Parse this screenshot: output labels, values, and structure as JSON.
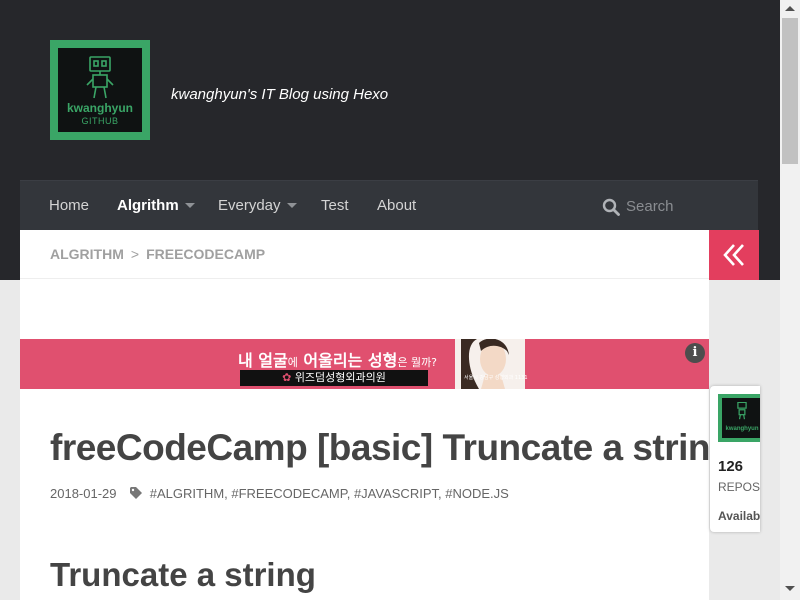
{
  "header": {
    "logo": {
      "name": "kwanghyun",
      "sub": "GITHUB"
    },
    "tagline": "kwanghyun's IT Blog using Hexo"
  },
  "nav": {
    "items": [
      {
        "label": "Home"
      },
      {
        "label": "Algrithm",
        "active": true,
        "dropdown": true
      },
      {
        "label": "Everyday",
        "dropdown": true
      },
      {
        "label": "Test"
      },
      {
        "label": "About"
      }
    ],
    "search_placeholder": "Search"
  },
  "breadcrumb": [
    "ALGRITHM",
    "FREECODECAMP"
  ],
  "ad": {
    "headline_a": "내 얼굴",
    "headline_b": "에",
    "headline_c": " 어울리는 성형",
    "headline_d": "은 뭘까?",
    "clinic": "위즈덤성형외과의원",
    "fineprint": "서울시 강남구 성형외과 1131",
    "info": "i"
  },
  "post": {
    "title": "freeCodeCamp [basic] Truncate a string",
    "date": "2018-01-29",
    "tags": "#ALGRITHM, #FREECODECAMP, #JAVASCRIPT, #NODE.JS",
    "section_title": "Truncate a string"
  },
  "github_card": {
    "logo_name": "kwanghyun",
    "repo_count": "126",
    "repo_label": "REPOS",
    "status": "Availab"
  },
  "colors": {
    "header_bg": "#26272b",
    "nav_bg": "#33363b",
    "accent": "#e33e5e",
    "brand_green": "#3aa566",
    "ad_bg": "#e0506f"
  }
}
